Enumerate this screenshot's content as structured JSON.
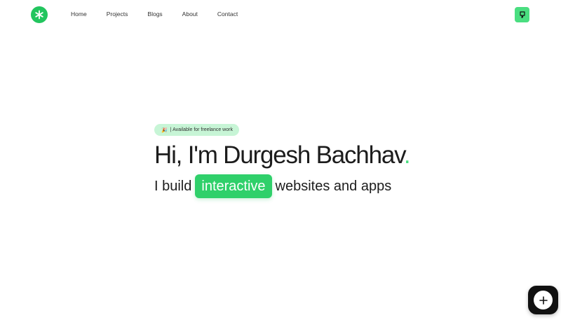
{
  "header": {
    "logo_icon": "asterisk-icon",
    "nav": [
      {
        "label": "Home"
      },
      {
        "label": "Projects"
      },
      {
        "label": "Blogs"
      },
      {
        "label": "About"
      },
      {
        "label": "Contact"
      }
    ],
    "theme_button_icon": "thumbs-down-icon"
  },
  "hero": {
    "badge_emoji": "🎉",
    "badge_text": "| Available for freelance work",
    "title": "Hi, I'm Durgesh Bachhav",
    "title_dot": ".",
    "subtitle_prefix": "I build",
    "subtitle_highlight": "interactive",
    "subtitle_suffix": "websites and apps"
  },
  "fab": {
    "icon": "plus-icon"
  },
  "colors": {
    "accent": "#22c55e",
    "accent_light": "#4ade80",
    "badge_bg": "#c7f5d6",
    "fab_bg": "#111111"
  }
}
